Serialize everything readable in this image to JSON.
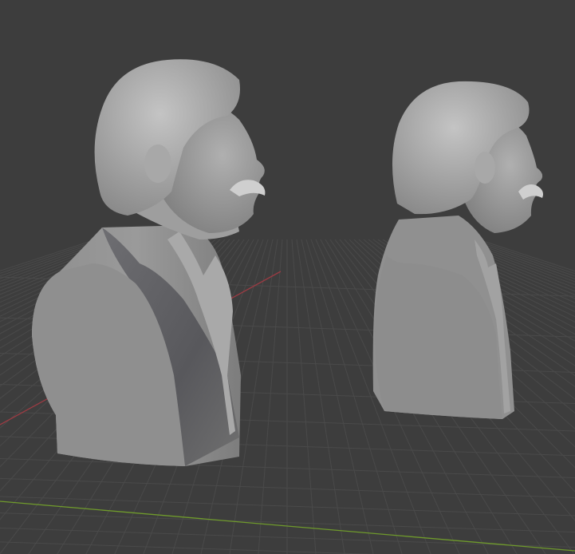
{
  "viewport": {
    "background": "#3d3d3d",
    "grid_color": "#4a4a4a",
    "x_axis_color": "#9a3b43",
    "y_axis_color": "#6f9a2c"
  },
  "objects": [
    {
      "name": "bust-left"
    },
    {
      "name": "bust-right"
    }
  ]
}
